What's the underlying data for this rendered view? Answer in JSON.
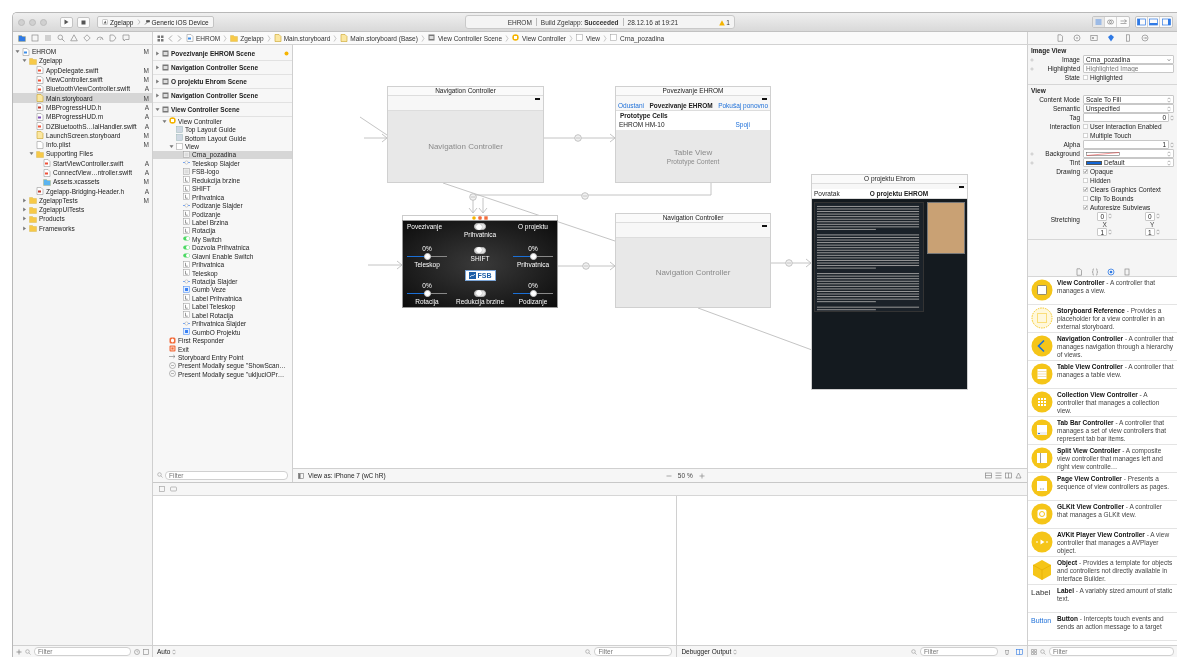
{
  "toolbar": {
    "scheme": "Zgelapp",
    "device": "Generic iOS Device",
    "activity": {
      "project": "EHROM",
      "build": "Build Zgelapp: **Succeeded**",
      "time": "28.12.16 at 19:21"
    },
    "warnings": "1"
  },
  "navigator_tabs": [
    {
      "kind": "folder",
      "selected": true
    },
    {
      "kind": "square",
      "selected": false
    },
    {
      "kind": "list",
      "selected": false
    },
    {
      "kind": "search",
      "selected": false
    },
    {
      "kind": "warning",
      "selected": false
    },
    {
      "kind": "diamond",
      "selected": false
    },
    {
      "kind": "gauge",
      "selected": false
    },
    {
      "kind": "tag",
      "selected": false
    },
    {
      "kind": "bubble",
      "selected": false
    }
  ],
  "jump_bar": [
    {
      "kind": "project",
      "text": "EHROM"
    },
    {
      "kind": "folder",
      "text": "Zgelapp"
    },
    {
      "kind": "storyboard",
      "text": "Main.storyboard"
    },
    {
      "kind": "storyboard",
      "text": "Main.storyboard (Base)"
    },
    {
      "kind": "scene",
      "text": "View Controller Scene"
    },
    {
      "kind": "vc",
      "text": "View Controller"
    },
    {
      "kind": "view",
      "text": "View"
    },
    {
      "kind": "view",
      "text": "Crna_pozadina"
    }
  ],
  "inspector_tabs": [
    {
      "kind": "file",
      "selected": false
    },
    {
      "kind": "help",
      "selected": false
    },
    {
      "kind": "identity",
      "selected": false
    },
    {
      "kind": "attributes",
      "selected": true
    },
    {
      "kind": "size",
      "selected": false
    },
    {
      "kind": "connections",
      "selected": false
    }
  ],
  "navigator": {
    "tree": [
      {
        "name": "EHROM",
        "kind": "project",
        "status": "M",
        "expanded": true,
        "selected": false,
        "children": [
          {
            "name": "Zgelapp",
            "kind": "folder",
            "expanded": true,
            "selected": false,
            "children": [
              {
                "name": "AppDelegate.swift",
                "kind": "swift",
                "status": "M",
                "selected": false
              },
              {
                "name": "ViewController.swift",
                "kind": "swift",
                "status": "M",
                "selected": false
              },
              {
                "name": "BluetoothViewController.swift",
                "kind": "swift",
                "status": "A",
                "selected": false
              },
              {
                "name": "Main.storyboard",
                "kind": "storyboard",
                "status": "M",
                "selected": true
              },
              {
                "name": "MBProgressHUD.h",
                "kind": "header",
                "status": "A",
                "selected": false
              },
              {
                "name": "MBProgressHUD.m",
                "kind": "objc",
                "status": "A",
                "selected": false
              },
              {
                "name": "DZBluetoothS…lalHandler.swift",
                "kind": "swift",
                "status": "A",
                "selected": false
              },
              {
                "name": "LaunchScreen.storyboard",
                "kind": "storyboard",
                "status": "M",
                "selected": false
              },
              {
                "name": "Info.plist",
                "kind": "plist",
                "status": "M",
                "selected": false
              },
              {
                "name": "Supporting Files",
                "kind": "folder",
                "expanded": true,
                "selected": false,
                "children": [
                  {
                    "name": "StartViewController.swift",
                    "kind": "swift",
                    "status": "A",
                    "selected": false
                  },
                  {
                    "name": "ConnectView…ntroller.swift",
                    "kind": "swift",
                    "status": "A",
                    "selected": false
                  },
                  {
                    "name": "Assets.xcassets",
                    "kind": "assets",
                    "status": "M",
                    "selected": false
                  }
                ]
              },
              {
                "name": "Zgelapp-Bridging-Header.h",
                "kind": "header",
                "status": "A",
                "selected": false
              }
            ]
          },
          {
            "name": "ZgelappTests",
            "kind": "folder",
            "status": "M",
            "expanded": false,
            "selected": false
          },
          {
            "name": "ZgelappUITests",
            "kind": "folder",
            "expanded": false,
            "selected": false
          },
          {
            "name": "Products",
            "kind": "folder",
            "expanded": false,
            "selected": false
          },
          {
            "name": "Frameworks",
            "kind": "folder",
            "expanded": false,
            "selected": false
          }
        ]
      }
    ],
    "filter": {
      "placeholder": "Filter"
    }
  },
  "outline": {
    "tree": [
      {
        "name": "Povezivanje EHROM Scene",
        "kind": "scene",
        "warning": true,
        "expanded": false,
        "selected": false
      },
      {
        "name": "Navigation Controller Scene",
        "kind": "scene",
        "warning": false,
        "expanded": false,
        "selected": false
      },
      {
        "name": "O projektu Ehrom Scene",
        "kind": "scene",
        "warning": false,
        "expanded": false,
        "selected": false
      },
      {
        "name": "Navigation Controller Scene",
        "kind": "scene",
        "warning": false,
        "expanded": false,
        "selected": false
      },
      {
        "name": "View Controller Scene",
        "kind": "scene",
        "warning": false,
        "expanded": true,
        "selected": false,
        "children": [
          {
            "name": "View Controller",
            "kind": "vc",
            "expanded": true,
            "selected": false,
            "children": [
              {
                "name": "Top Layout Guide",
                "kind": "guide",
                "selected": false
              },
              {
                "name": "Bottom Layout Guide",
                "kind": "guide",
                "selected": false
              },
              {
                "name": "View",
                "kind": "view",
                "expanded": true,
                "selected": false,
                "children": [
                  {
                    "name": "Crna_pozadina",
                    "kind": "image",
                    "selected": true
                  },
                  {
                    "name": "Teleskop Slajder",
                    "kind": "slider",
                    "selected": false
                  },
                  {
                    "name": "FSB-logo",
                    "kind": "image",
                    "selected": false
                  },
                  {
                    "name": "Redukcija brzine",
                    "kind": "label",
                    "selected": false
                  },
                  {
                    "name": "SHIFT",
                    "kind": "label",
                    "selected": false
                  },
                  {
                    "name": "Prihvatnica",
                    "kind": "label",
                    "selected": false
                  },
                  {
                    "name": "Podizanje Slajder",
                    "kind": "slider",
                    "selected": false
                  },
                  {
                    "name": "Podizanje",
                    "kind": "label",
                    "selected": false
                  },
                  {
                    "name": "Label Brzina",
                    "kind": "label",
                    "selected": false
                  },
                  {
                    "name": "Rotacija",
                    "kind": "label",
                    "selected": false
                  },
                  {
                    "name": "My Switch",
                    "kind": "switch",
                    "selected": false
                  },
                  {
                    "name": "Dozvola Prihvatnica",
                    "kind": "switch",
                    "selected": false
                  },
                  {
                    "name": "Glavni Enable Switch",
                    "kind": "switch",
                    "selected": false
                  },
                  {
                    "name": "Prihvatnica",
                    "kind": "label",
                    "selected": false
                  },
                  {
                    "name": "Teleskop",
                    "kind": "label",
                    "selected": false
                  },
                  {
                    "name": "Rotacija Slajder",
                    "kind": "slider",
                    "selected": false
                  },
                  {
                    "name": "Gumb Veze",
                    "kind": "button",
                    "selected": false
                  },
                  {
                    "name": "Label Prihvatnica",
                    "kind": "label",
                    "selected": false
                  },
                  {
                    "name": "Label Teleskop",
                    "kind": "label",
                    "selected": false
                  },
                  {
                    "name": "Label Rotacija",
                    "kind": "label",
                    "selected": false
                  },
                  {
                    "name": "Prihvatnica Slajder",
                    "kind": "slider",
                    "selected": false
                  },
                  {
                    "name": "GumbO Projektu",
                    "kind": "button",
                    "selected": false
                  }
                ]
              }
            ]
          },
          {
            "name": "First Responder",
            "kind": "responder",
            "selected": false
          },
          {
            "name": "Exit",
            "kind": "exit",
            "selected": false
          },
          {
            "name": "Storyboard Entry Point",
            "kind": "entry",
            "selected": false
          },
          {
            "name": "Present Modally segue \"ShowScan…",
            "kind": "segue",
            "selected": false
          },
          {
            "name": "Present Modally segue \"ukljuciOPr…",
            "kind": "segue",
            "selected": false
          }
        ]
      }
    ],
    "filter": {
      "placeholder": "Filter"
    }
  },
  "canvas": {
    "scenes": [
      {
        "kind": "navigation",
        "title": "Navigation Controller",
        "label": "Navigation Controller"
      },
      {
        "kind": "table",
        "title": "Povezivanje EHROM",
        "nav": {
          "left": "Odustani",
          "center": "Povezivanje EHROM",
          "right": "Pokušaj ponovno"
        },
        "section": "Prototype Cells",
        "cell": {
          "text": "EHROM HM-10",
          "accessory": "Spoji"
        },
        "label": "Table View",
        "sublabel": "Prototype Content"
      },
      {
        "kind": "controls",
        "corner_left": "Povezivanje",
        "corner_right": "O projektu",
        "logo": "FSB",
        "switches": [
          {
            "label": "Prihvatnica",
            "on": false
          },
          {
            "label": "SHIFT",
            "on": false
          },
          {
            "label": "Redukcija brzine",
            "on": false
          }
        ],
        "sliders": [
          {
            "value": "0%",
            "label": "Teleskop",
            "level": 0.5
          },
          {
            "value": "0%",
            "label": "Prihvatnica",
            "level": 0.5
          },
          {
            "value": "0%",
            "label": "Rotacija",
            "level": 0.5
          },
          {
            "value": "0%",
            "label": "Podizanje",
            "level": 0.5
          }
        ]
      },
      {
        "kind": "navigation",
        "title": "Navigation Controller",
        "label": "Navigation Controller"
      },
      {
        "kind": "about",
        "title": "O projektu Ehrom",
        "nav": {
          "left": "Povratak",
          "center": "O projektu EHROM"
        }
      }
    ],
    "view_as": "View as: iPhone 7 (wC hR)",
    "zoom": "50 %"
  },
  "debug": {
    "scope": "Auto",
    "output": "Debugger Output",
    "filters": [
      {
        "placeholder": "Filter"
      },
      {
        "placeholder": "Filter"
      }
    ]
  },
  "inspector": {
    "sections": [
      {
        "title": "Image View",
        "rows": [
          {
            "kind": "combo",
            "label": "Image",
            "value": "Crna_pozadina",
            "plus": true
          },
          {
            "kind": "combo",
            "label": "Highlighted",
            "placeholder": "Highlighted Image",
            "plus": true
          },
          {
            "kind": "check",
            "label": "State",
            "text": "Highlighted",
            "checked": false
          }
        ]
      },
      {
        "title": "View",
        "rows": [
          {
            "kind": "popup",
            "label": "Content Mode",
            "value": "Scale To Fill"
          },
          {
            "kind": "popup",
            "label": "Semantic",
            "value": "Unspecified"
          },
          {
            "kind": "stepper",
            "label": "Tag",
            "value": "0"
          },
          {
            "kind": "check",
            "label": "Interaction",
            "text": "User Interaction Enabled",
            "checked": false
          },
          {
            "kind": "check",
            "text": "Multiple Touch",
            "checked": false
          },
          {
            "kind": "stepper",
            "label": "Alpha",
            "value": "1"
          },
          {
            "kind": "color",
            "label": "Background",
            "plus": true
          },
          {
            "kind": "color",
            "label": "Tint",
            "color": "#1266d6",
            "value": "Default",
            "plus": true
          },
          {
            "kind": "check",
            "label": "Drawing",
            "text": "Opaque",
            "checked": true
          },
          {
            "kind": "check",
            "text": "Hidden",
            "checked": false
          },
          {
            "kind": "check",
            "text": "Clears Graphics Context",
            "checked": true
          },
          {
            "kind": "check",
            "text": "Clip To Bounds",
            "checked": false
          },
          {
            "kind": "check",
            "text": "Autoresize Subviews",
            "checked": true
          },
          {
            "kind": "pair",
            "label": "Stretching",
            "values": [
              "0",
              "0"
            ],
            "captions": [
              "X",
              "Y"
            ]
          },
          {
            "kind": "pair",
            "values": [
              "1",
              "1"
            ]
          }
        ]
      }
    ]
  },
  "library_tabs": [
    {
      "kind": "file",
      "selected": false
    },
    {
      "kind": "braces",
      "selected": false
    },
    {
      "kind": "object",
      "selected": true
    },
    {
      "kind": "media",
      "selected": false
    }
  ],
  "library": {
    "items": [
      {
        "kind": "view-controller",
        "text": "**View Controller** - A controller that manages a view."
      },
      {
        "kind": "storyboard-reference",
        "text": "**Storyboard Reference** - Provides a placeholder for a view controller in an external storyboard."
      },
      {
        "kind": "navigation",
        "text": "**Navigation Controller** - A controller that manages navigation through a hierarchy of views."
      },
      {
        "kind": "table",
        "text": "**Table View Controller** - A controller that manages a table view."
      },
      {
        "kind": "collection",
        "text": "**Collection View Controller** - A controller that manages a collection view."
      },
      {
        "kind": "tab-bar",
        "text": "**Tab Bar Controller** - A controller that manages a set of view controllers that represent tab bar items."
      },
      {
        "kind": "split",
        "text": "**Split View Controller** - A composite view controller that manages left and right view controlle…"
      },
      {
        "kind": "page",
        "text": "**Page View Controller** - Presents a sequence of view controllers as pages."
      },
      {
        "kind": "glkit",
        "text": "**GLKit View Controller** - A controller that manages a GLKit view."
      },
      {
        "kind": "avkit",
        "text": "**AVKit Player View Controller** - A view controller that manages a AVPlayer object."
      },
      {
        "kind": "object",
        "text": "**Object** - Provides a template for objects and controllers not directly available in Interface Builder."
      },
      {
        "kind": "label",
        "preview": "Label",
        "text": "**Label** - A variably sized amount of static text."
      },
      {
        "kind": "button",
        "preview": "Button",
        "text": "**Button** - Intercepts touch events and sends an action message to a target"
      }
    ],
    "filter": {
      "placeholder": "Filter"
    }
  }
}
